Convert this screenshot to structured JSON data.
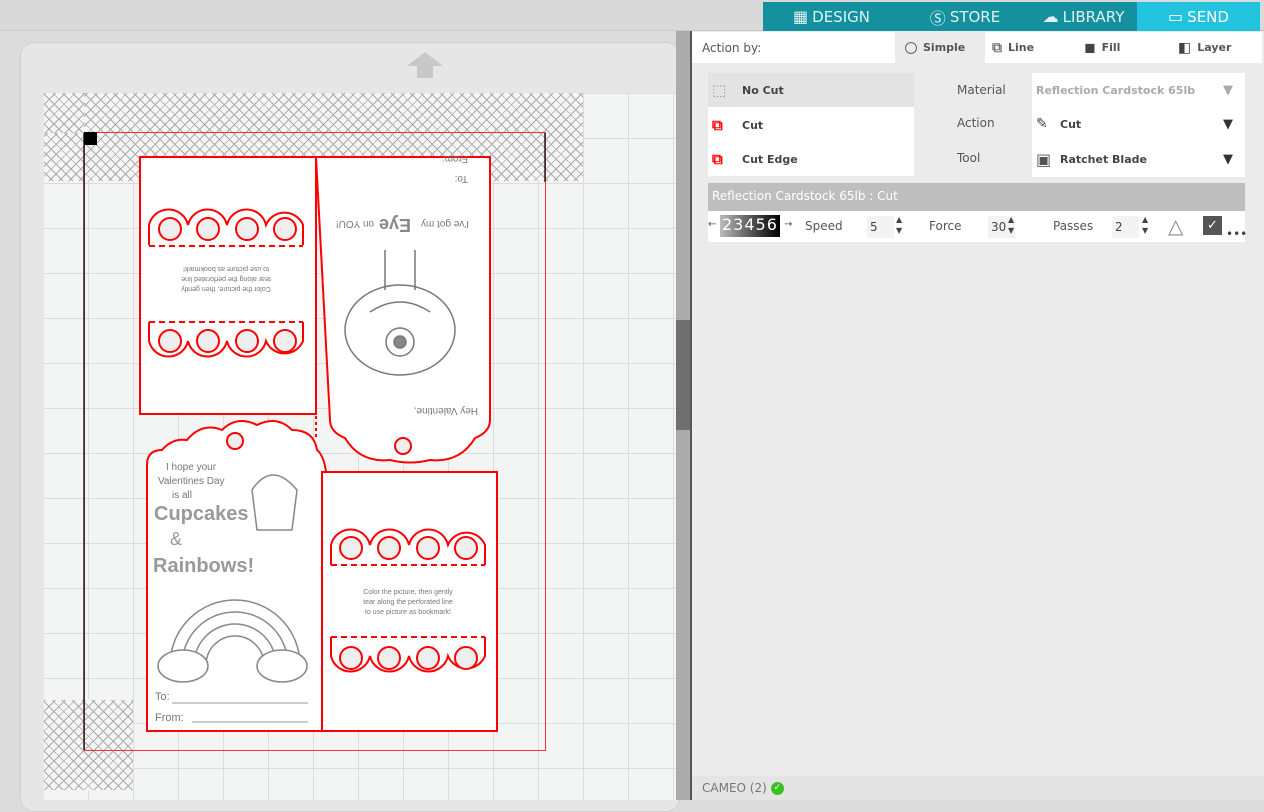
{
  "nav": {
    "tabs": [
      {
        "label": "DESIGN",
        "icon": "grid-icon"
      },
      {
        "label": "STORE",
        "icon": "silhouette-s-icon"
      },
      {
        "label": "LIBRARY",
        "icon": "cloud-download-icon"
      },
      {
        "label": "SEND",
        "icon": "plotter-icon",
        "active": true
      }
    ]
  },
  "action_by": {
    "label": "Action by:",
    "tabs": [
      {
        "label": "Simple",
        "selected": true
      },
      {
        "label": "Line"
      },
      {
        "label": "Fill"
      },
      {
        "label": "Layer"
      }
    ]
  },
  "cut_options": [
    {
      "label": "No Cut",
      "selected": true
    },
    {
      "label": "Cut"
    },
    {
      "label": "Cut Edge"
    }
  ],
  "settings": {
    "material_label": "Material",
    "material_value": "Reflection Cardstock 65lb",
    "action_label": "Action",
    "action_value": "Cut",
    "tool_label": "Tool",
    "tool_value": "Ratchet Blade"
  },
  "material_bar": "Reflection Cardstock 65lb : Cut",
  "params": {
    "blade_strip": "23456",
    "speed_label": "Speed",
    "speed": "5",
    "force_label": "Force",
    "force": "30",
    "passes_label": "Passes",
    "passes": "2"
  },
  "status": {
    "device": "CAMEO (2)"
  },
  "artwork": {
    "card1_text": [
      "Color the picture, then gently",
      "tear along the perforated line",
      "to use picture as bookmark!"
    ],
    "card2": {
      "from": "From:",
      "to": "To:",
      "line1a": "I've got my",
      "eye": "Eye",
      "line1b": "on YOU!",
      "greeting": "Hey Valentine,"
    },
    "card3": {
      "lines": [
        "I hope your",
        "Valentines Day",
        "is all"
      ],
      "big1": "Cupcakes",
      "amp": "&",
      "big2": "Rainbows!",
      "to": "To:",
      "from": "From:"
    },
    "card4_text": [
      "Color the picture, then gently",
      "tear along the perforated line",
      "to use picture as bookmark!"
    ]
  },
  "colors": {
    "nav": "#14909e",
    "nav_active": "#22c3df",
    "cut_line": "#ff0000",
    "status_ok": "#3cc021"
  }
}
